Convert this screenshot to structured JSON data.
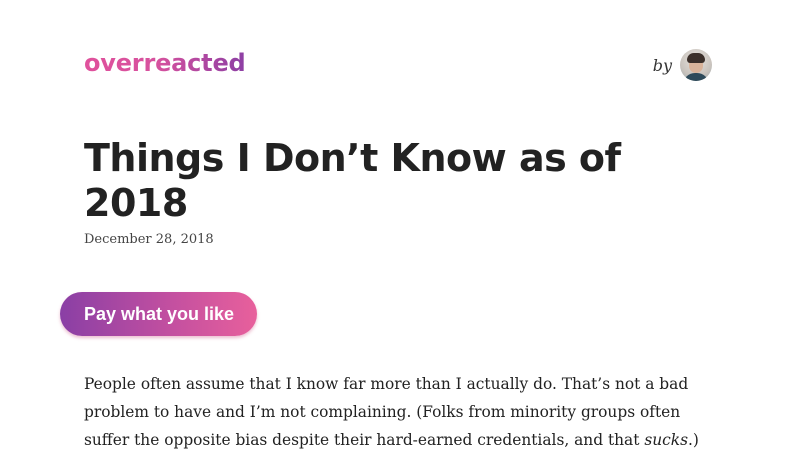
{
  "header": {
    "logo_text": "overreacted",
    "byline_text": "by",
    "avatar_icon": "author-avatar"
  },
  "post": {
    "title": "Things I Don’t Know as of 2018",
    "date": "December 28, 2018",
    "pay_button_label": "Pay what you like",
    "paragraph_part1": "People often assume that I know far more than I actually do. That’s not a bad problem to have and I’m not complaining. (Folks from minority groups often suffer the opposite bias despite their hard-earned credentials, and that ",
    "paragraph_emphasis": "sucks",
    "paragraph_part2": ".)"
  },
  "colors": {
    "logo_gradient_start": "#e0519c",
    "logo_gradient_end": "#8c3fa4",
    "button_gradient_start": "#8a3fa5",
    "button_gradient_end": "#e8609c",
    "text": "#222222"
  }
}
